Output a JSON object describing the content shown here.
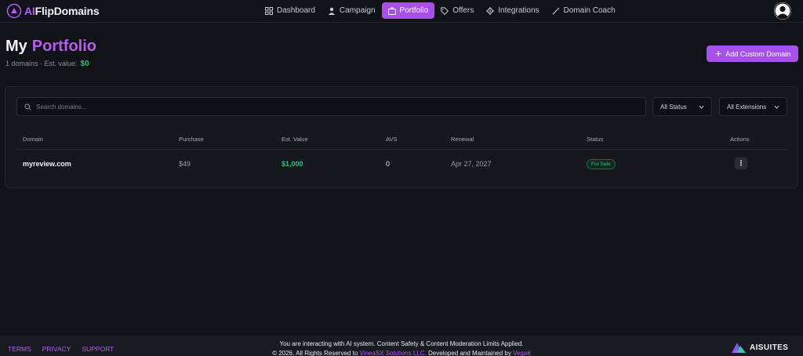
{
  "brand": {
    "prefix": "AI",
    "name": "FlipDomains"
  },
  "nav": {
    "items": [
      {
        "label": "Dashboard",
        "icon": "grid-icon",
        "active": false
      },
      {
        "label": "Campaign",
        "icon": "user-icon",
        "active": false
      },
      {
        "label": "Portfolio",
        "icon": "briefcase-icon",
        "active": true
      },
      {
        "label": "Offers",
        "icon": "tag-icon",
        "active": false
      },
      {
        "label": "Integrations",
        "icon": "gear-icon",
        "active": false
      },
      {
        "label": "Domain Coach",
        "icon": "wand-icon",
        "active": false
      }
    ]
  },
  "header": {
    "title_first": "My",
    "title_accent": "Portfolio",
    "summary": "1 domains · Est. value:",
    "est_value": "$0",
    "add_button": "Add Custom Domain"
  },
  "filters": {
    "search_placeholder": "Search domains...",
    "status": "All Status",
    "extensions": "All Extensions"
  },
  "table": {
    "columns": [
      "Domain",
      "Purchase",
      "Est. Value",
      "AVS",
      "Renewal",
      "Status",
      "Actions"
    ],
    "rows": [
      {
        "domain": "myreview.com",
        "purchase": "$49",
        "est_value": "$1,000",
        "avs": "0",
        "renewal": "Apr 27, 2027",
        "status": "For Sale",
        "actions": "⋮"
      }
    ]
  },
  "footer": {
    "links": [
      "TERMS",
      "PRIVACY",
      "SUPPORT"
    ],
    "notice": "You are interacting with AI system. Content Safety & Content Moderation Limits Applied.",
    "copyright_a": "© 2026. All Rights Reserved to",
    "company": "VineaSX Solutions LLC.",
    "copyright_b": "Developed and Maintained by",
    "maintainer": "Vega6",
    "brand": "AISUITES"
  },
  "colors": {
    "accent": "#a750e8",
    "success": "#2ec27e",
    "background": "#121318"
  }
}
